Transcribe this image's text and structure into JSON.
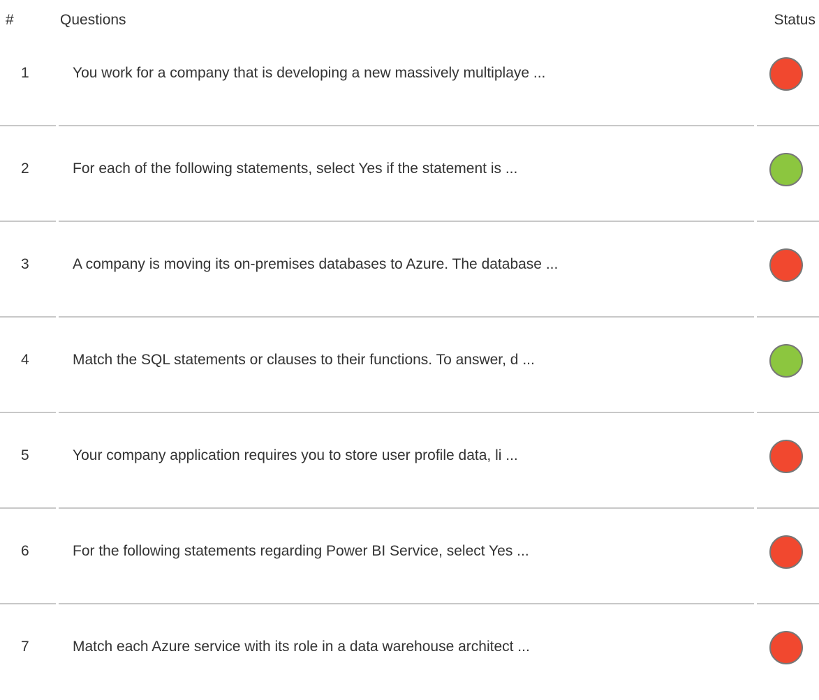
{
  "header": {
    "num_label": "#",
    "questions_label": "Questions",
    "status_label": "Status"
  },
  "colors": {
    "incorrect": "#f1482f",
    "correct": "#8cc63f",
    "divider": "#c8c8c8",
    "text": "#333333"
  },
  "rows": [
    {
      "num": "1",
      "question": "You work for a company that is developing a new massively multiplaye ...",
      "status": "incorrect"
    },
    {
      "num": "2",
      "question": "For each of the following statements, select Yes if the statement is ...",
      "status": "correct"
    },
    {
      "num": "3",
      "question": "A company is moving its on-premises databases to Azure. The database ...",
      "status": "incorrect"
    },
    {
      "num": "4",
      "question": "Match the SQL statements or clauses to their functions. To answer, d ...",
      "status": "correct"
    },
    {
      "num": "5",
      "question": "Your company application requires you to store user profile data, li ...",
      "status": "incorrect"
    },
    {
      "num": "6",
      "question": "For the following statements regarding Power BI Service, select Yes ...",
      "status": "incorrect"
    },
    {
      "num": "7",
      "question": "Match each Azure service with its role in a data warehouse architect ...",
      "status": "incorrect"
    }
  ]
}
